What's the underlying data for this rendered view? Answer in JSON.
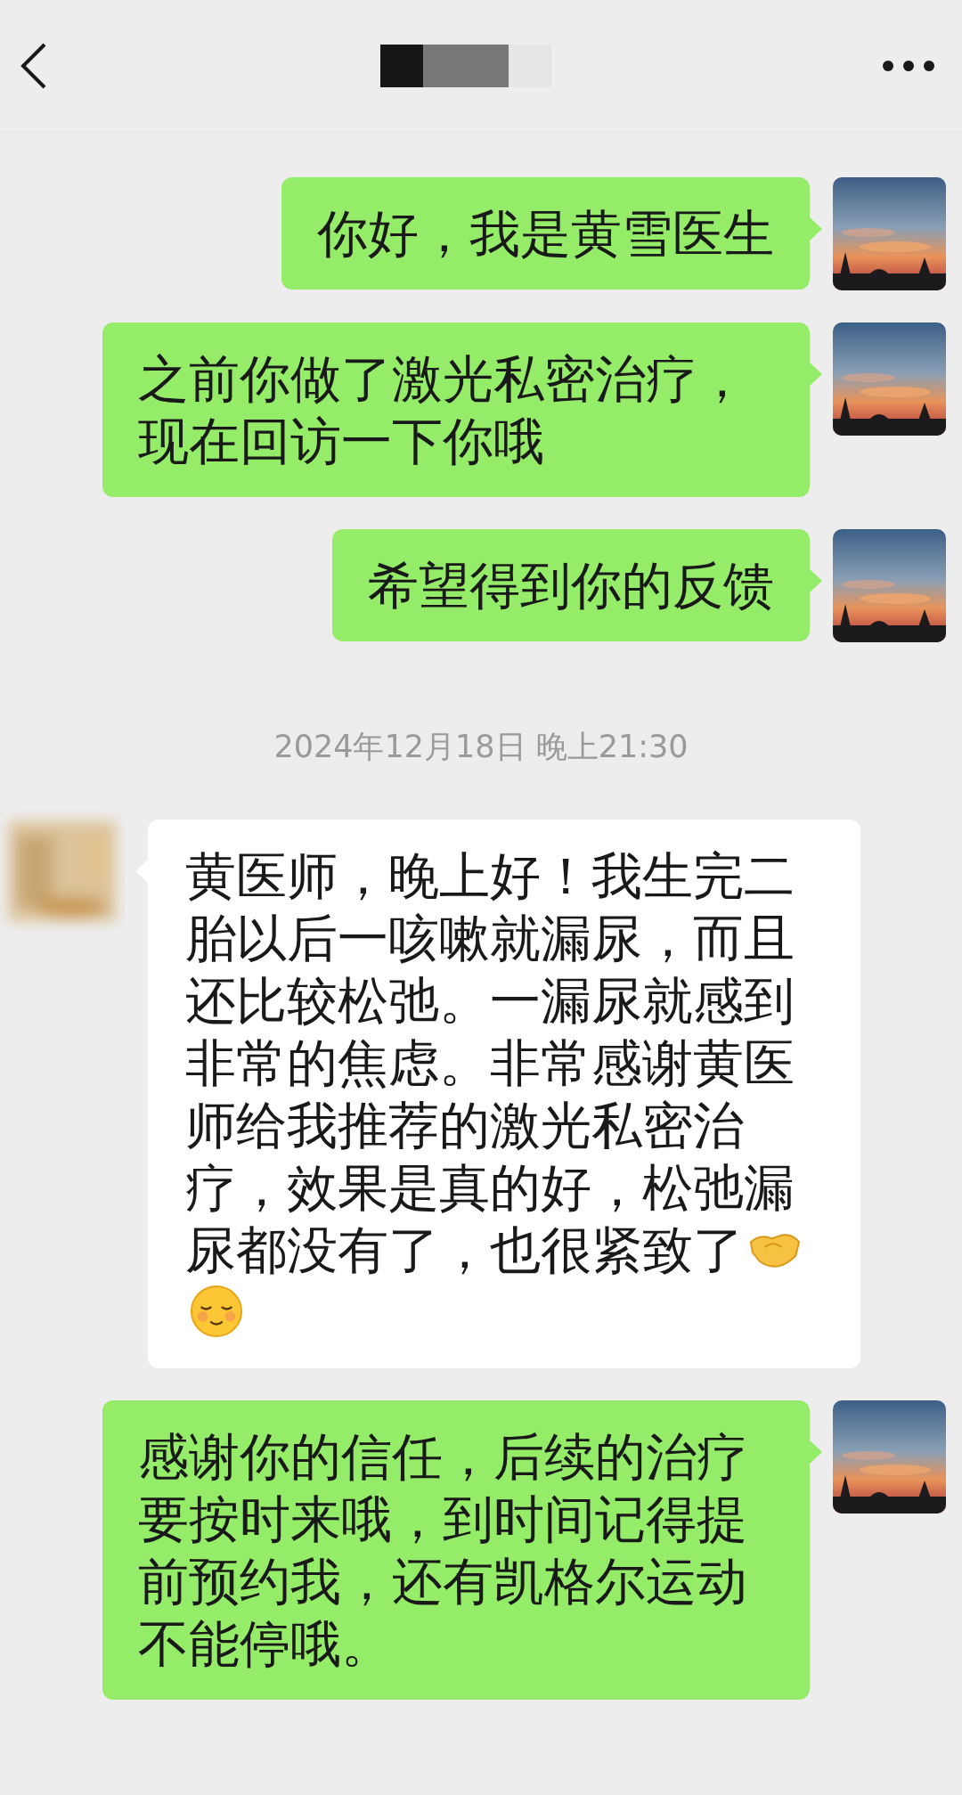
{
  "messages": [
    {
      "kind": "sent",
      "text": "你好，我是黄雪医生"
    },
    {
      "kind": "sent",
      "text": "之前你做了激光私密治疗，现在回访一下你哦"
    },
    {
      "kind": "sent",
      "text": "希望得到你的反馈"
    },
    {
      "kind": "time",
      "text": "2024年12月18日 晚上21:30"
    },
    {
      "kind": "received",
      "text": "黄医师，晚上好！我生完二胎以后一咳嗽就漏尿，而且还比较松弛。一漏尿就感到非常的焦虑。非常感谢黄医师给我推荐的激光私密治疗，效果是真的好，松弛漏尿都没有了，也很紧致了",
      "with_emojis": true
    },
    {
      "kind": "sent",
      "text": "感谢你的信任，后续的治疗要按时来哦，到时间记得提前预约我，还有凯格尔运动不能停哦。"
    }
  ]
}
